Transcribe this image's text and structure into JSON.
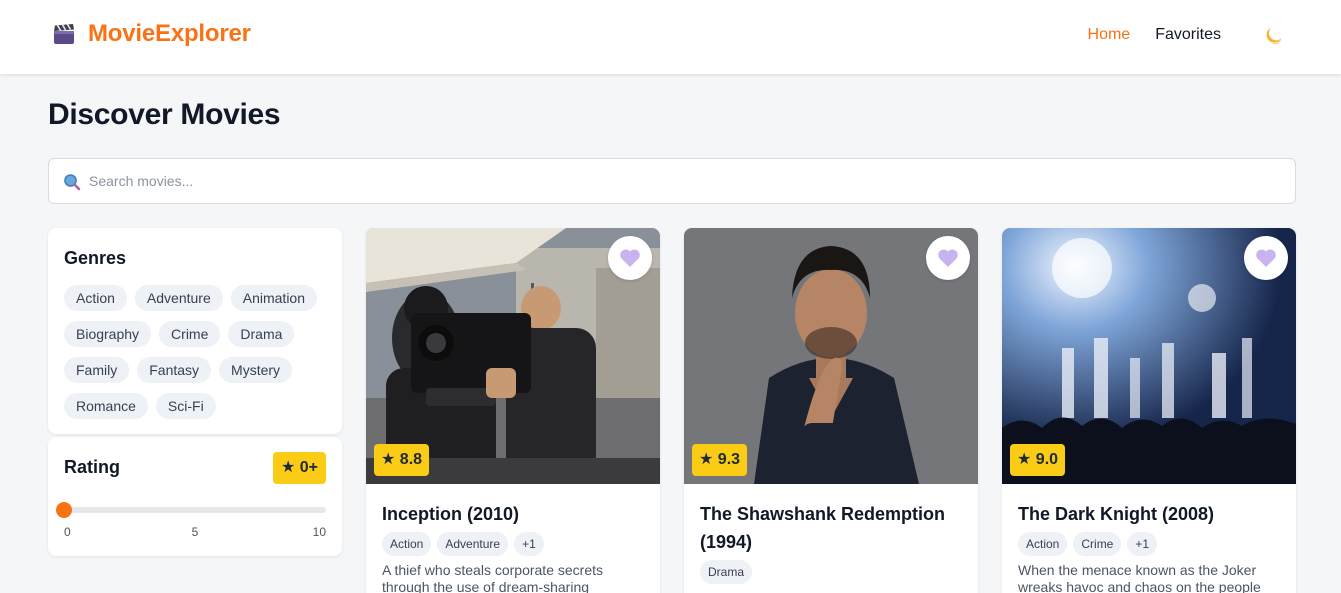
{
  "app": {
    "name": "MovieExplorer",
    "logo_icon": "clapperboard-icon",
    "accent": "#f97316"
  },
  "nav": {
    "items": [
      {
        "label": "Home",
        "active": true
      },
      {
        "label": "Favorites",
        "active": false
      }
    ],
    "theme_icon": "moon-icon"
  },
  "page": {
    "title": "Discover Movies"
  },
  "search": {
    "placeholder": "Search movies...",
    "value": "",
    "icon": "search-icon"
  },
  "filters": {
    "genres": {
      "title": "Genres",
      "items": [
        "Action",
        "Adventure",
        "Animation",
        "Biography",
        "Crime",
        "Drama",
        "Family",
        "Fantasy",
        "Mystery",
        "Romance",
        "Sci-Fi"
      ]
    },
    "rating": {
      "title": "Rating",
      "badge": "★ 0+",
      "min": 0,
      "max": 10,
      "value": 0,
      "ticks": [
        "0",
        "5",
        "10"
      ]
    }
  },
  "movies": [
    {
      "title": "Inception (2010)",
      "rating": "★ 8.8",
      "tags": [
        "Action",
        "Adventure",
        "+1"
      ],
      "description": "A thief who steals corporate secrets through the use of dream-sharing",
      "favorite_icon": "heart-icon"
    },
    {
      "title": "The Shawshank Redemption (1994)",
      "rating": "★ 9.3",
      "tags": [
        "Drama"
      ],
      "description": "",
      "favorite_icon": "heart-icon"
    },
    {
      "title": "The Dark Knight (2008)",
      "rating": "★ 9.0",
      "tags": [
        "Action",
        "Crime",
        "+1"
      ],
      "description": "When the menace known as the Joker wreaks havoc and chaos on the people",
      "favorite_icon": "heart-icon"
    }
  ],
  "colors": {
    "rating_badge": "#facc15",
    "heart": "#c9b3ef",
    "chip_bg": "#eef1f5"
  }
}
